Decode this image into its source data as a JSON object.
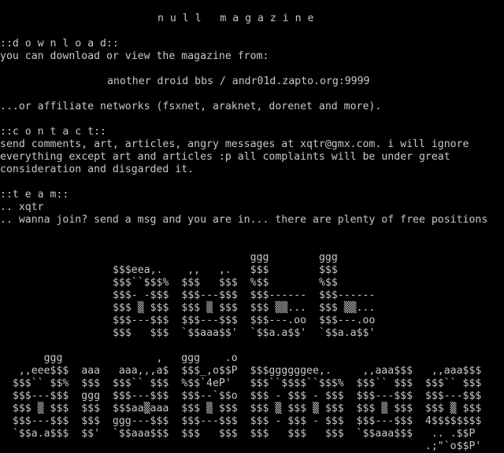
{
  "title": "n u l l   m a g a z i n e",
  "download": {
    "heading": "::d o w n l o a d::",
    "intro": "you can download or view the magazine from:",
    "bbs": "another droid bbs / andr01d.zapto.org:9999",
    "networks": "...or affiliate networks (fsxnet, araknet, dorenet and more)."
  },
  "contact": {
    "heading": "::c o n t a c t::",
    "line1": "send comments, art, articles, angry messages at xqtr@gmx.com. i will ignore",
    "line2": "everything except art and articles :p all complaints will be under great",
    "line3": "consideration and disgarded it."
  },
  "team": {
    "heading": "::t e a m::",
    "member": ".. xqtr",
    "join": ".. wanna join? send a msg and you are in... there are plenty of free positions"
  },
  "logo": {
    "top": [
      "                                       ggg        ggg",
      "                 $$$eea,.    ,,   ,.   $$$        $$$",
      "                 $$$``$$$%  $$$   $$$  %$$        %$$",
      "                 $$$- -$$$  $$$---$$$  $$$------  $$$------",
      "                 $$$ ▒ $$$  $$$ ▒ $$$  $$$ ▒▒...  $$$ ▒▒...",
      "                 $$$---$$$  $$$---$$$  $$$---.oo  $$$---.oo",
      "                 $$$   $$$  `$$aaa$$'  `$$a.a$$'  `$$a.a$$'"
    ],
    "bottom": [
      "       ggg               ,   ggg    .o",
      "   ,,eee$$$  aaa   aaa,,,a$  $$$_,o$$P  $$$ggggggee,.     ,,aaa$$$   ,,aaa$$$",
      "  $$$`` $$%  $$$  $$$`` $$$  %$$`4eP'   $$$``$$$$``$$$%  $$$`` $$$  $$$`` $$$",
      "  $$$---$$$  ggg  $$$---$$$  $$$--`$$o  $$$ - $$$ - $$$  $$$---$$$  $$$---$$$",
      "  $$$ ▒ $$$  $$$  $$$aa▒aaa  $$$ ▒ $$$  $$$ ▒ $$$ ▒ $$$  $$$ ▒ $$$  $$$ ▒ $$$",
      "  $$$---$$$  $$$  ggg---$$$  $$$---$$$  $$$ - $$$ - $$$  $$$---$$$  4$$$$$$$$",
      "  `$$a.a$$$  $$'  `$$aaa$$$  $$$   $$$  $$$   $$$   $$$  `$$aaa$$$   .. .$$P",
      "                                                                    .;\"`o$$P'"
    ]
  }
}
